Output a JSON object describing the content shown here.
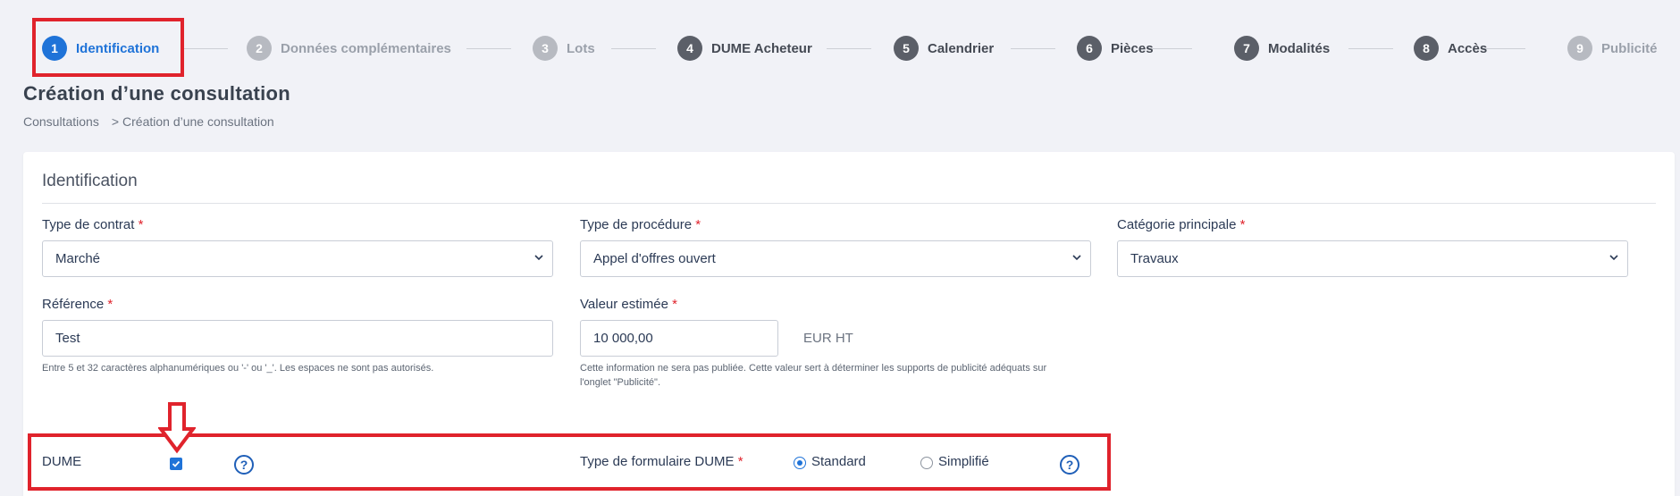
{
  "stepper": {
    "steps": [
      {
        "num": "1",
        "label": "Identification",
        "state": "active"
      },
      {
        "num": "2",
        "label": "Données complémentaires",
        "state": "muted"
      },
      {
        "num": "3",
        "label": "Lots",
        "state": "muted"
      },
      {
        "num": "4",
        "label": "DUME Acheteur",
        "state": "default"
      },
      {
        "num": "5",
        "label": "Calendrier",
        "state": "default"
      },
      {
        "num": "6",
        "label": "Pièces",
        "state": "default"
      },
      {
        "num": "7",
        "label": "Modalités",
        "state": "default"
      },
      {
        "num": "8",
        "label": "Accès",
        "state": "default"
      },
      {
        "num": "9",
        "label": "Publicité",
        "state": "muted"
      }
    ]
  },
  "header": {
    "title": "Création d’une consultation",
    "breadcrumb": {
      "root": "Consultations",
      "separator": ">",
      "current": "Création d’une consultation"
    }
  },
  "form": {
    "section_title": "Identification",
    "required_mark": "*",
    "contract_type": {
      "label": "Type de contrat",
      "value": "Marché"
    },
    "procedure_type": {
      "label": "Type de procédure",
      "value": "Appel d'offres ouvert"
    },
    "main_category": {
      "label": "Catégorie principale",
      "value": "Travaux"
    },
    "reference": {
      "label": "Référence",
      "value": "Test",
      "help": "Entre 5 et 32 caractères alphanumériques ou '-' ou '_'. Les espaces ne sont pas autorisés."
    },
    "estimated_value": {
      "label": "Valeur estimée",
      "value": "10 000,00",
      "unit": "EUR HT",
      "help_line1": "Cette information ne sera pas publiée. Cette valeur sert à déterminer les supports de publicité adéquats sur",
      "help_line2": "l'onglet \"Publicité\"."
    },
    "dume": {
      "label": "DUME",
      "checked": true,
      "help_glyph": "?"
    },
    "dume_form_type": {
      "label": "Type de formulaire DUME",
      "options": [
        "Standard",
        "Simplifié"
      ],
      "selected": "Standard",
      "help_glyph": "?"
    }
  },
  "colors": {
    "accent": "#1f73d8",
    "annotation_red": "#e0232c",
    "required_red": "#e0232c",
    "step_default": "#5b5f68",
    "step_muted": "#b7bac1"
  }
}
